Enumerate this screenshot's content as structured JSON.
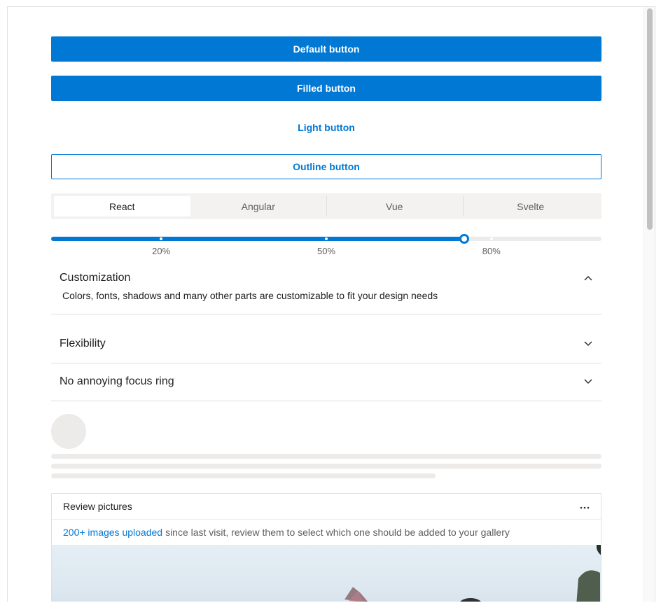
{
  "buttons": {
    "default_label": "Default button",
    "filled_label": "Filled button",
    "light_label": "Light button",
    "outline_label": "Outline button"
  },
  "tabs": [
    {
      "label": "React",
      "active": true
    },
    {
      "label": "Angular",
      "active": false
    },
    {
      "label": "Vue",
      "active": false
    },
    {
      "label": "Svelte",
      "active": false
    }
  ],
  "slider": {
    "value_percent": 75,
    "marks": [
      {
        "value": 20,
        "label": "20%"
      },
      {
        "value": 50,
        "label": "50%"
      },
      {
        "value": 80,
        "label": "80%"
      }
    ]
  },
  "accordion": [
    {
      "title": "Customization",
      "expanded": true,
      "body": "Colors, fonts, shadows and many other parts are customizable to fit your design needs"
    },
    {
      "title": "Flexibility",
      "expanded": false,
      "body": ""
    },
    {
      "title": "No annoying focus ring",
      "expanded": false,
      "body": ""
    }
  ],
  "card": {
    "title": "Review pictures",
    "more_icon": "more-horizontal-icon",
    "link_text": "200+ images uploaded",
    "text": "since last visit, review them to select which one should be added to your gallery"
  },
  "colors": {
    "accent": "#0078d4",
    "skeleton": "#edebe9",
    "border": "#e1dfdd"
  }
}
